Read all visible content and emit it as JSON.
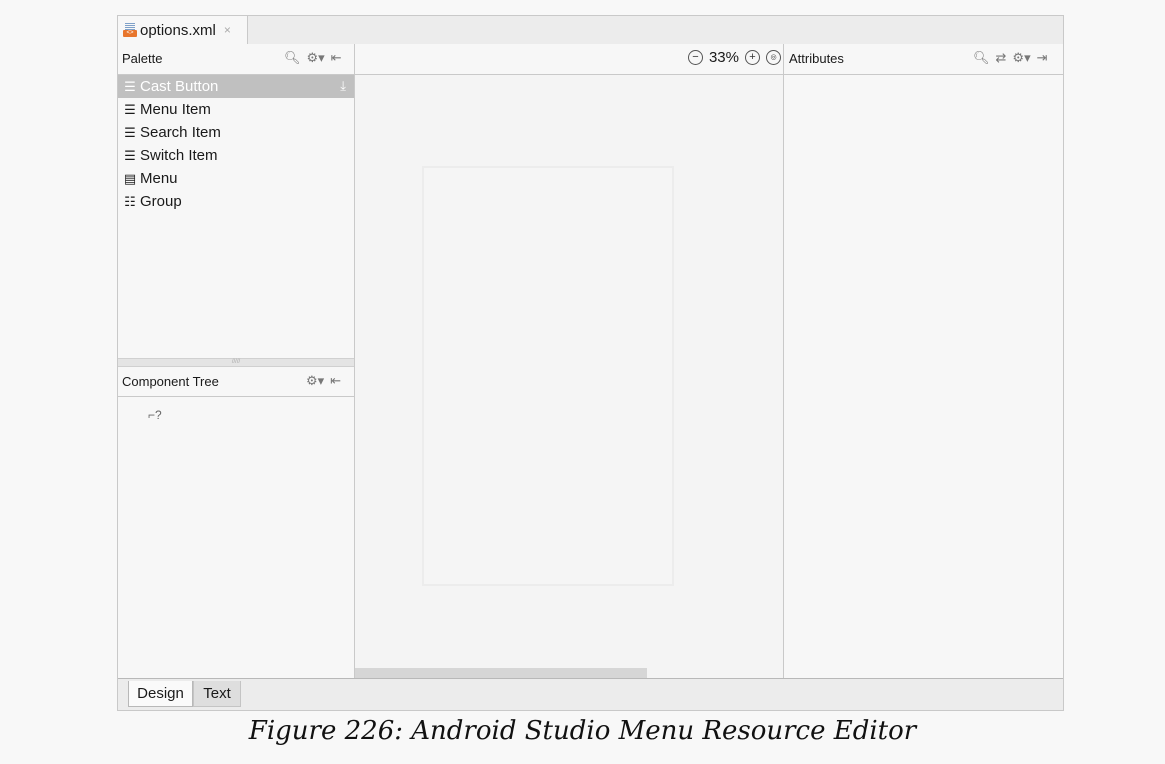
{
  "file_tab": {
    "label": "options.xml",
    "close": "×",
    "icon": "xml-file-icon"
  },
  "palette": {
    "title": "Palette",
    "items": [
      {
        "label": "Cast Button",
        "icon": "list-icon",
        "selected": true
      },
      {
        "label": "Menu Item",
        "icon": "list-icon"
      },
      {
        "label": "Search Item",
        "icon": "list-icon"
      },
      {
        "label": "Switch Item",
        "icon": "list-icon"
      },
      {
        "label": "Menu",
        "icon": "menu-icon"
      },
      {
        "label": "Group",
        "icon": "grid-icon"
      }
    ]
  },
  "component_tree": {
    "title": "Component Tree"
  },
  "canvas": {
    "zoom": "33%"
  },
  "attributes": {
    "title": "Attributes"
  },
  "bottom_tabs": {
    "design": "Design",
    "text": "Text"
  },
  "caption": "Figure 226: Android Studio Menu Resource Editor"
}
